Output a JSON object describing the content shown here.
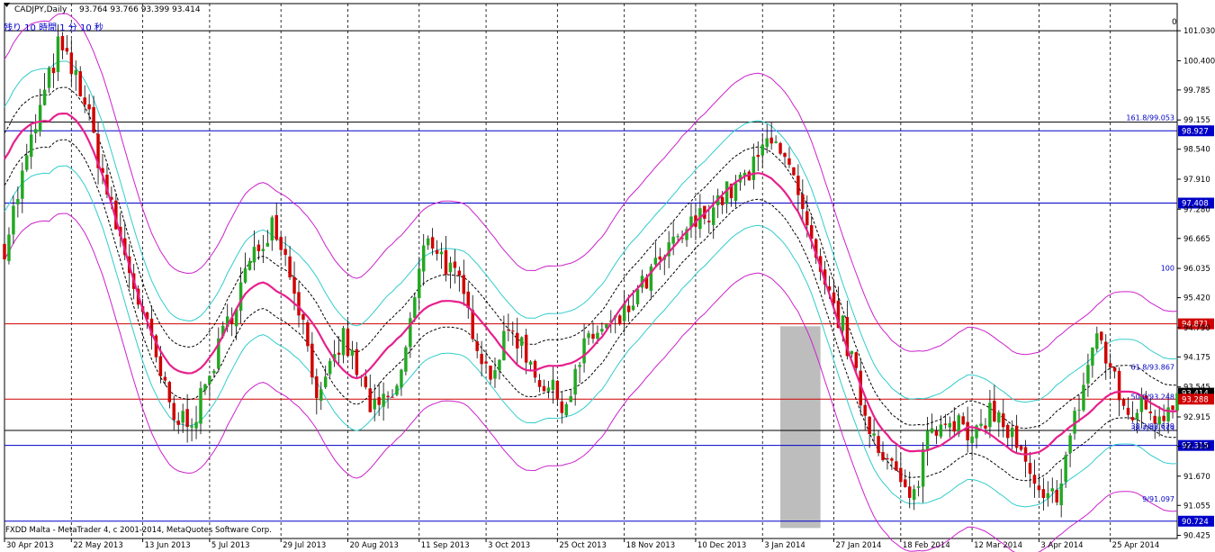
{
  "window": {
    "title": "CADJPY,Daily",
    "ohlc": "93.764 93.766 93.399 93.414",
    "countdown": "残り 10 時間 1 分 10 秒",
    "copyright": "FXDD Malta - MetaTrader 4, c 2001-2014, MetaQuotes Software Corp.",
    "corner_label": "0"
  },
  "colors": {
    "bull": "#22a822",
    "bear": "#d00000",
    "ma": "#e6208c",
    "outer_band": "#cc22cc",
    "inner_band": "#33cccc",
    "fib": "#0000c8",
    "red_line": "#d00000",
    "shade": "#bdbdbd"
  },
  "chart_data": {
    "type": "candlestick",
    "symbol": "CADJPY",
    "timeframe": "Daily",
    "y_ticks": [
      "101.030",
      "100.400",
      "99.785",
      "99.155",
      "98.540",
      "97.910",
      "97.280",
      "96.665",
      "96.035",
      "95.420",
      "94.790",
      "94.175",
      "93.545",
      "92.915",
      "92.300",
      "91.670",
      "91.055",
      "90.425"
    ],
    "y_range": [
      90.36,
      101.6
    ],
    "x_ticks": [
      "30 Apr 2013",
      "22 May 2013",
      "13 Jun 2013",
      "5 Jul 2013",
      "29 Jul 2013",
      "20 Aug 2013",
      "11 Sep 2013",
      "3 Oct 2013",
      "25 Oct 2013",
      "18 Nov 2013",
      "10 Dec 2013",
      "3 Jan 2014",
      "27 Jan 2014",
      "18 Feb 2014",
      "12 Mar 2014",
      "3 Apr 2014",
      "25 Apr 2014"
    ],
    "bars": 264,
    "price_path": [
      [
        0,
        96.5
      ],
      [
        8,
        99.0
      ],
      [
        14,
        100.7
      ],
      [
        20,
        99.8
      ],
      [
        28,
        97.2
      ],
      [
        38,
        94.5
      ],
      [
        44,
        92.8
      ],
      [
        50,
        93.0
      ],
      [
        55,
        94.2
      ],
      [
        62,
        95.8
      ],
      [
        70,
        97.1
      ],
      [
        76,
        95.5
      ],
      [
        82,
        93.2
      ],
      [
        88,
        94.6
      ],
      [
        96,
        93.0
      ],
      [
        102,
        93.4
      ],
      [
        110,
        96.8
      ],
      [
        118,
        95.7
      ],
      [
        126,
        93.8
      ],
      [
        132,
        94.8
      ],
      [
        140,
        93.6
      ],
      [
        146,
        93.2
      ],
      [
        152,
        94.6
      ],
      [
        160,
        94.9
      ],
      [
        168,
        95.9
      ],
      [
        176,
        96.7
      ],
      [
        186,
        97.5
      ],
      [
        194,
        98.0
      ],
      [
        200,
        99.0
      ],
      [
        206,
        97.6
      ],
      [
        212,
        95.8
      ],
      [
        218,
        94.8
      ],
      [
        224,
        92.9
      ],
      [
        230,
        92.0
      ],
      [
        236,
        91.0
      ],
      [
        240,
        92.6
      ],
      [
        246,
        93.0
      ],
      [
        252,
        92.3
      ],
      [
        256,
        93.1
      ],
      [
        262,
        92.5
      ],
      [
        270,
        91.0
      ],
      [
        274,
        91.4
      ],
      [
        280,
        93.4
      ],
      [
        284,
        94.7
      ],
      [
        288,
        93.8
      ],
      [
        292,
        92.9
      ],
      [
        296,
        93.2
      ],
      [
        300,
        92.9
      ],
      [
        305,
        93.4
      ]
    ],
    "bands": [
      {
        "name": "Moving Average",
        "role": "ma"
      },
      {
        "name": "Envelope inner",
        "role": "inner",
        "width": 1.1
      },
      {
        "name": "Envelope outer",
        "role": "outer",
        "width": 2.1
      },
      {
        "name": "Envelope mid",
        "role": "mid",
        "width": 0.55
      }
    ],
    "horizontal_lines": [
      {
        "value": 101.03,
        "color": "#000000"
      },
      {
        "value": 99.11,
        "color": "#000000"
      },
      {
        "value": 98.927,
        "color": "#0000c8"
      },
      {
        "value": 97.408,
        "color": "#0000c8"
      },
      {
        "value": 94.871,
        "color": "#d00000"
      },
      {
        "value": 93.288,
        "color": "#d00000"
      },
      {
        "value": 92.63,
        "color": "#000000"
      },
      {
        "value": 92.315,
        "color": "#0000c8"
      },
      {
        "value": 90.724,
        "color": "#0000c8"
      }
    ],
    "fib_levels": [
      {
        "label": "161.8/99.053",
        "value": 99.11
      },
      {
        "label": "100",
        "value": 95.95
      },
      {
        "label": "61.8/93.867",
        "value": 93.867
      },
      {
        "label": "50.0/93.248",
        "value": 93.248
      },
      {
        "label": "38.2/92.629",
        "value": 92.629
      },
      {
        "label": "38.2/92.579",
        "value": 92.579
      },
      {
        "label": "9/91.097",
        "value": 91.097
      }
    ],
    "price_tags": [
      {
        "label": "98.927",
        "value": 98.927,
        "color": "#0000c8"
      },
      {
        "label": "97.408",
        "value": 97.408,
        "color": "#0000c8"
      },
      {
        "label": "94.871",
        "value": 94.871,
        "color": "#d00000"
      },
      {
        "label": "93.414",
        "value": 93.414,
        "color": "#000000"
      },
      {
        "label": "93.288",
        "value": 93.288,
        "color": "#d00000"
      },
      {
        "label": "92.315",
        "value": 92.315,
        "color": "#0000c8"
      },
      {
        "label": "90.724",
        "value": 90.724,
        "color": "#0000c8"
      }
    ],
    "shaded_zone": {
      "from_date": "13 Dec 2013",
      "to_date": "3 Jan 2014",
      "top": 94.82,
      "bottom": 90.58
    }
  }
}
